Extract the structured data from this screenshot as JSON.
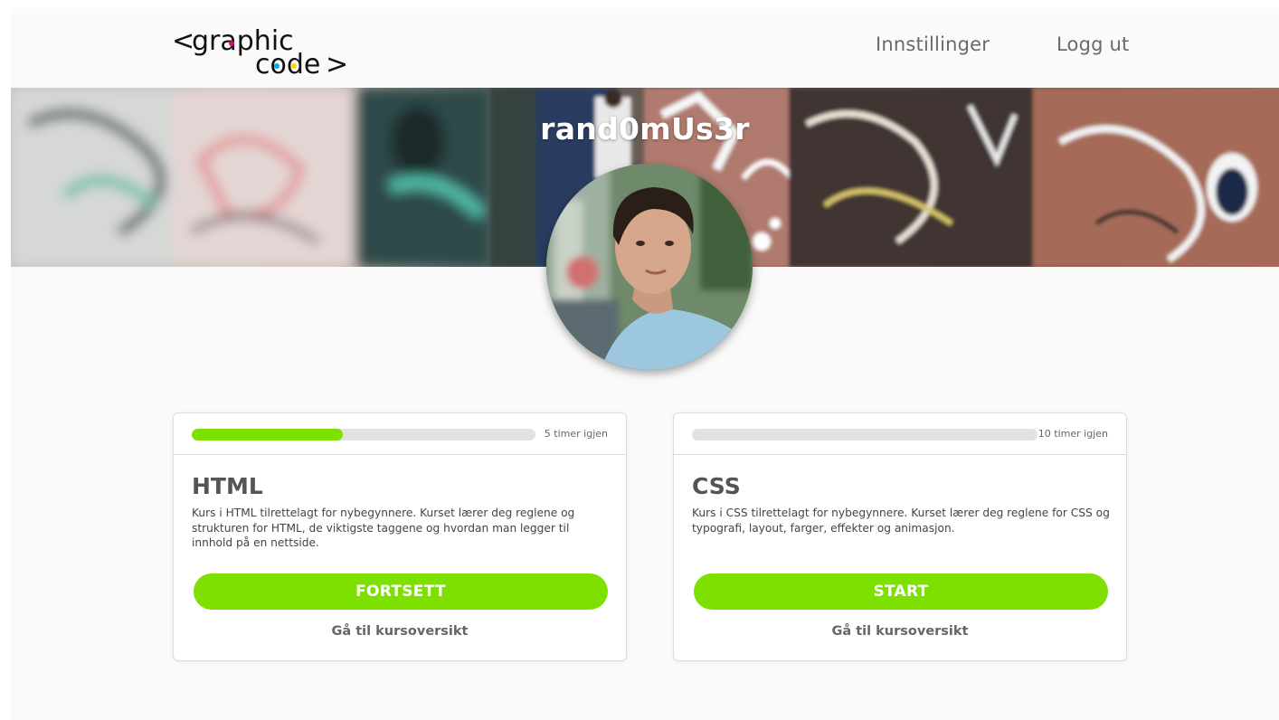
{
  "header": {
    "logo": {
      "line1": "graphic",
      "line2": "code",
      "open": "<",
      "close": ">"
    },
    "nav": {
      "settings": "Innstillinger",
      "logout": "Logg ut"
    }
  },
  "profile": {
    "username": "rand0mUs3r"
  },
  "courses": [
    {
      "title": "HTML",
      "time_left": "5 timer igjen",
      "progress": 0.44,
      "description": "Kurs i HTML tilrettelagt for nybegynnere. Kurset lærer deg reglene og strukturen for HTML, de viktigste taggene og hvordan man legger til innhold på en nettside.",
      "button_label": "FORTSETT",
      "link_label": "Gå til kursoversikt"
    },
    {
      "title": "CSS",
      "time_left": "10 timer igjen",
      "progress": 0,
      "description": "Kurs i CSS tilrettelagt for nybegynnere. Kurset lærer deg reglene for CSS og typografi, layout, farger, effekter og animasjon.",
      "button_label": "START",
      "link_label": "Gå til kursoversikt"
    }
  ],
  "colors": {
    "accent": "#7ee000",
    "track": "#dfe3e3",
    "logo_dot_magenta": "#e5007e",
    "logo_dot_cyan": "#00aee8",
    "logo_dot_yellow": "#ffd800"
  }
}
